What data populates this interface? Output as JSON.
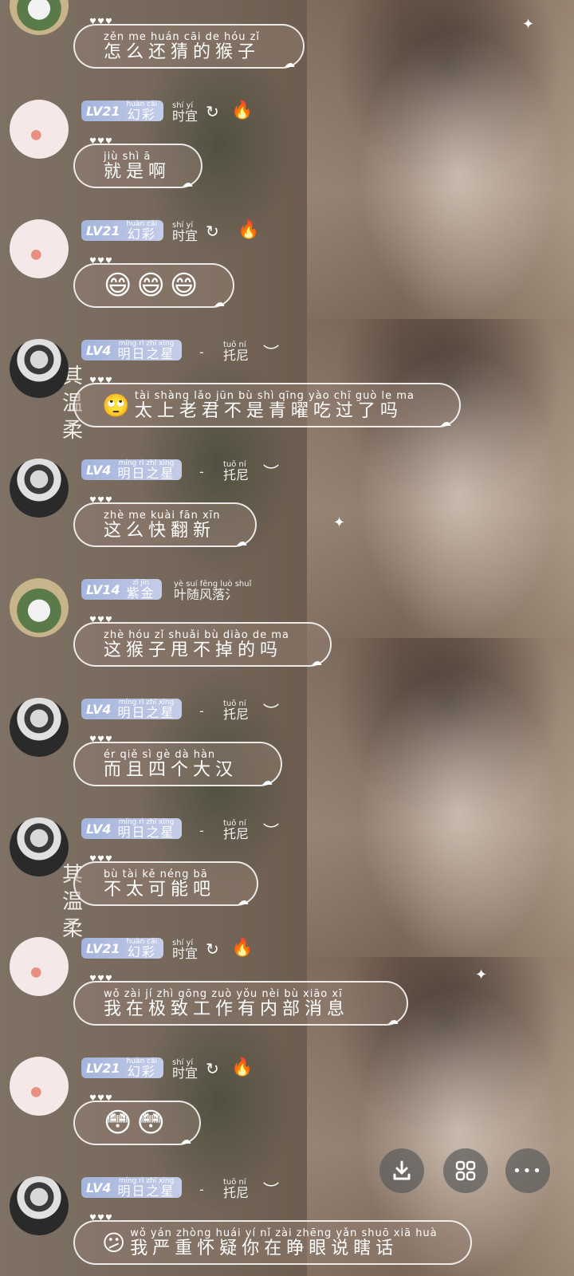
{
  "messages": [
    {
      "avatar": "duck",
      "level": "",
      "title_py": "",
      "title": "",
      "name_py": "",
      "name": "",
      "bubble_py": "zěn me huán cāi de hóu zǐ",
      "bubble": "怎么还猜的猴子"
    },
    {
      "avatar": "pink",
      "level": "LV21",
      "title_py": "huàn cǎi",
      "title": "幻彩",
      "name_py": "shí yí",
      "name": "时宜",
      "deco": "↻",
      "fire": "🔥",
      "bubble_py": "jiù shì ā",
      "bubble": "就是啊"
    },
    {
      "avatar": "pink",
      "level": "LV21",
      "title_py": "huàn cǎi",
      "title": "幻彩",
      "name_py": "shí yí",
      "name": "时宜",
      "deco": "↻",
      "fire": "🔥",
      "emoji": "😄😄😄"
    },
    {
      "avatar": "man",
      "level": "LV4",
      "title_py": "míng rì zhī xīng",
      "title": "明日之星",
      "dash": "-",
      "name_py": "tuō ní",
      "name": "托尼",
      "deco": "︶",
      "lead": "🙄",
      "bubble_py": "tài shàng lǎo jūn bù shì qīng yào chī guò le ma",
      "bubble": "太上老君不是青曜吃过了吗"
    },
    {
      "avatar": "man",
      "level": "LV4",
      "title_py": "míng rì zhī xīng",
      "title": "明日之星",
      "dash": "-",
      "name_py": "tuō ní",
      "name": "托尼",
      "deco": "︶",
      "bubble_py": "zhè me kuài fān xīn",
      "bubble": "这么快翻新"
    },
    {
      "avatar": "duck",
      "level": "LV14",
      "title_py": "zǐ jīn",
      "title": "紫金",
      "name_py": "yè suí fēng luò shuǐ",
      "name": "叶随风落氵",
      "bubble_py": "zhè hóu zǐ shuǎi bù diào de ma",
      "bubble": "这猴子甩不掉的吗"
    },
    {
      "avatar": "man",
      "level": "LV4",
      "title_py": "míng rì zhī xīng",
      "title": "明日之星",
      "dash": "-",
      "name_py": "tuō ní",
      "name": "托尼",
      "deco": "︶",
      "bubble_py": "ér qiě sì gè dà hàn",
      "bubble": "而且四个大汉"
    },
    {
      "avatar": "man",
      "level": "LV4",
      "title_py": "míng rì zhī xīng",
      "title": "明日之星",
      "dash": "-",
      "name_py": "tuō ní",
      "name": "托尼",
      "deco": "︶",
      "bubble_py": "bù tài kě néng bā",
      "bubble": "不太可能吧"
    },
    {
      "avatar": "pink",
      "level": "LV21",
      "title_py": "huàn cǎi",
      "title": "幻彩",
      "name_py": "shí yí",
      "name": "时宜",
      "deco": "↻",
      "fire": "🔥",
      "bubble_py": "wǒ zài jí zhì gōng zuò yǒu nèi bù xiāo xī",
      "bubble": "我在极致工作有内部消息"
    },
    {
      "avatar": "pink",
      "level": "LV21",
      "title_py": "huàn cǎi",
      "title": "幻彩",
      "name_py": "shí yí",
      "name": "时宜",
      "deco": "↻",
      "fire": "🔥",
      "emoji": "😳😳"
    },
    {
      "avatar": "man",
      "level": "LV4",
      "title_py": "míng rì zhī xīng",
      "title": "明日之星",
      "dash": "-",
      "name_py": "tuō ní",
      "name": "托尼",
      "deco": "︶",
      "lead": "😕",
      "bubble_py": "wǒ yán zhòng huái yí nǐ zài zhēng yǎn shuō xiā huà",
      "bubble": "我严重怀疑你在睁眼说瞎话"
    }
  ],
  "vertical_text": "其温柔",
  "dots": "♥♥♥",
  "cloud": "☁",
  "actions": {
    "download_icon": "download-icon",
    "grid_icon": "grid-icon",
    "more_icon": "more-icon",
    "more_glyph": "•••"
  }
}
